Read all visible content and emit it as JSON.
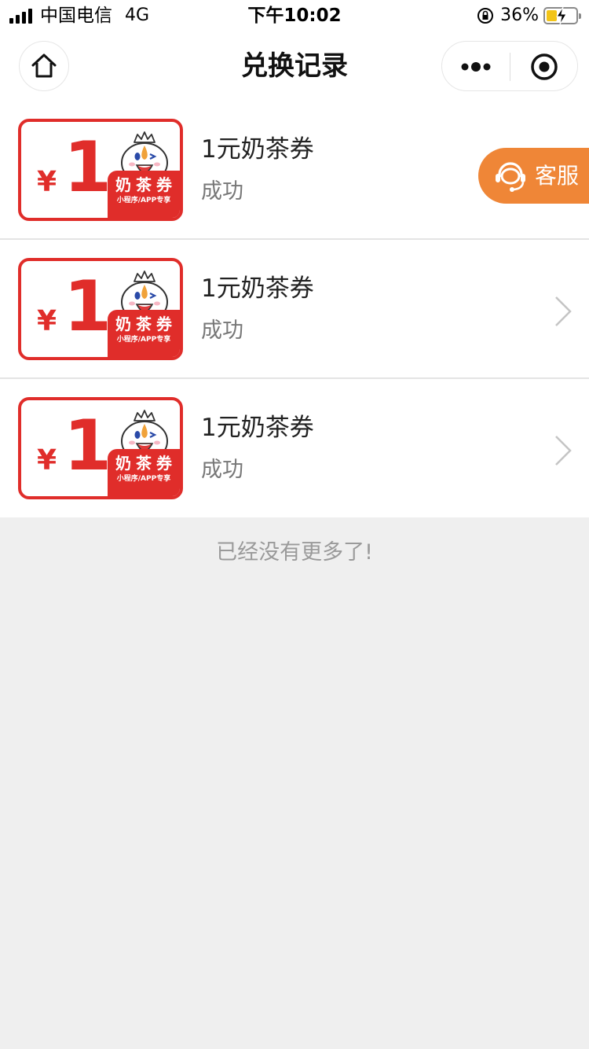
{
  "status_bar": {
    "carrier": "中国电信",
    "network": "4G",
    "time": "下午10:02",
    "battery_percent": "36%",
    "battery_level": 0.36
  },
  "nav": {
    "title": "兑换记录"
  },
  "records": [
    {
      "coupon_currency": "¥",
      "coupon_amount": "1",
      "coupon_badge_title": "奶茶券",
      "coupon_badge_sub": "小程序/APP专享",
      "title": "1元奶茶券",
      "status": "成功"
    },
    {
      "coupon_currency": "¥",
      "coupon_amount": "1",
      "coupon_badge_title": "奶茶券",
      "coupon_badge_sub": "小程序/APP专享",
      "title": "1元奶茶券",
      "status": "成功"
    },
    {
      "coupon_currency": "¥",
      "coupon_amount": "1",
      "coupon_badge_title": "奶茶券",
      "coupon_badge_sub": "小程序/APP专享",
      "title": "1元奶茶券",
      "status": "成功"
    }
  ],
  "footer": {
    "no_more": "已经没有更多了!"
  },
  "service_button": {
    "label": "客服"
  },
  "icons": [
    "signal-icon",
    "orientation-lock-icon",
    "battery-icon",
    "home-icon",
    "more-dots-icon",
    "target-close-icon",
    "mascot-icon",
    "chevron-right-icon",
    "headset-icon"
  ],
  "colors": {
    "coupon_red": "#e02d2a",
    "service_orange": "#ef8637",
    "background": "#efefef",
    "battery_yellow": "#f2c418"
  }
}
